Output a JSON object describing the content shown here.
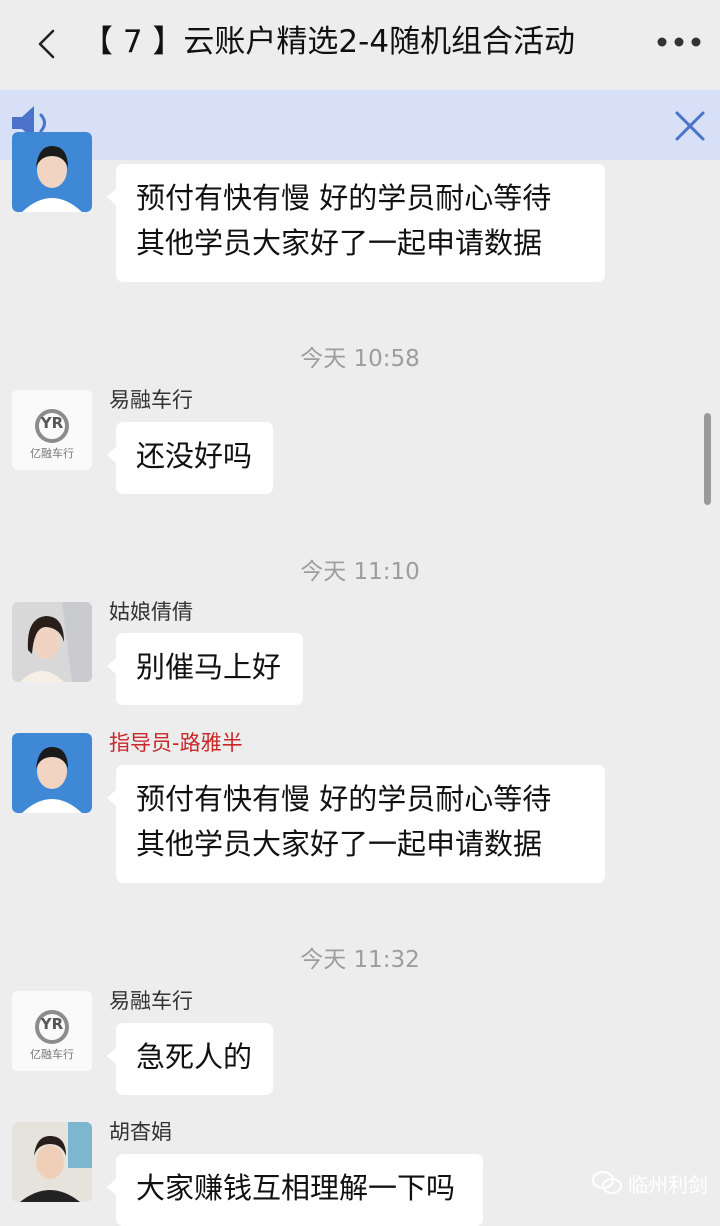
{
  "header": {
    "title": "【 7 】云账户精选2-4随机组合活动",
    "back_icon": "chevron-left-icon",
    "more_icon": "more-dots-icon"
  },
  "notice_bar": {
    "speaker_icon": "speaker-icon",
    "close_icon": "close-icon",
    "background": "#d7e0f7",
    "icon_color": "#4a73c9"
  },
  "messages": [
    {
      "type": "message",
      "sender": "",
      "avatar": "instructor-avatar",
      "text": "预付有快有慢 好的学员耐心等待\n其他学员大家好了一起申请数据"
    },
    {
      "type": "time",
      "text": "今天 10:58"
    },
    {
      "type": "message",
      "sender": "易融车行",
      "avatar": "yirong-logo-avatar",
      "text": "还没好吗"
    },
    {
      "type": "time",
      "text": "今天 11:10"
    },
    {
      "type": "message",
      "sender": "姑娘倩倩",
      "avatar": "woman-avatar",
      "text": "别催马上好"
    },
    {
      "type": "message",
      "sender": "指导员-路雅半",
      "sender_color": "#c8282a",
      "avatar": "instructor-avatar",
      "text": "预付有快有慢 好的学员耐心等待\n其他学员大家好了一起申请数据"
    },
    {
      "type": "time",
      "text": "今天 11:32"
    },
    {
      "type": "message",
      "sender": "易融车行",
      "avatar": "yirong-logo-avatar",
      "text": "急死人的"
    },
    {
      "type": "message",
      "sender": "胡杳娟",
      "avatar": "woman-avatar-2",
      "text": "大家赚钱互相理解一下吗"
    }
  ],
  "logo": {
    "monogram": "YR",
    "caption": "亿融车行"
  },
  "watermark": {
    "text": "临州利剑",
    "icon": "wechat-icon"
  }
}
